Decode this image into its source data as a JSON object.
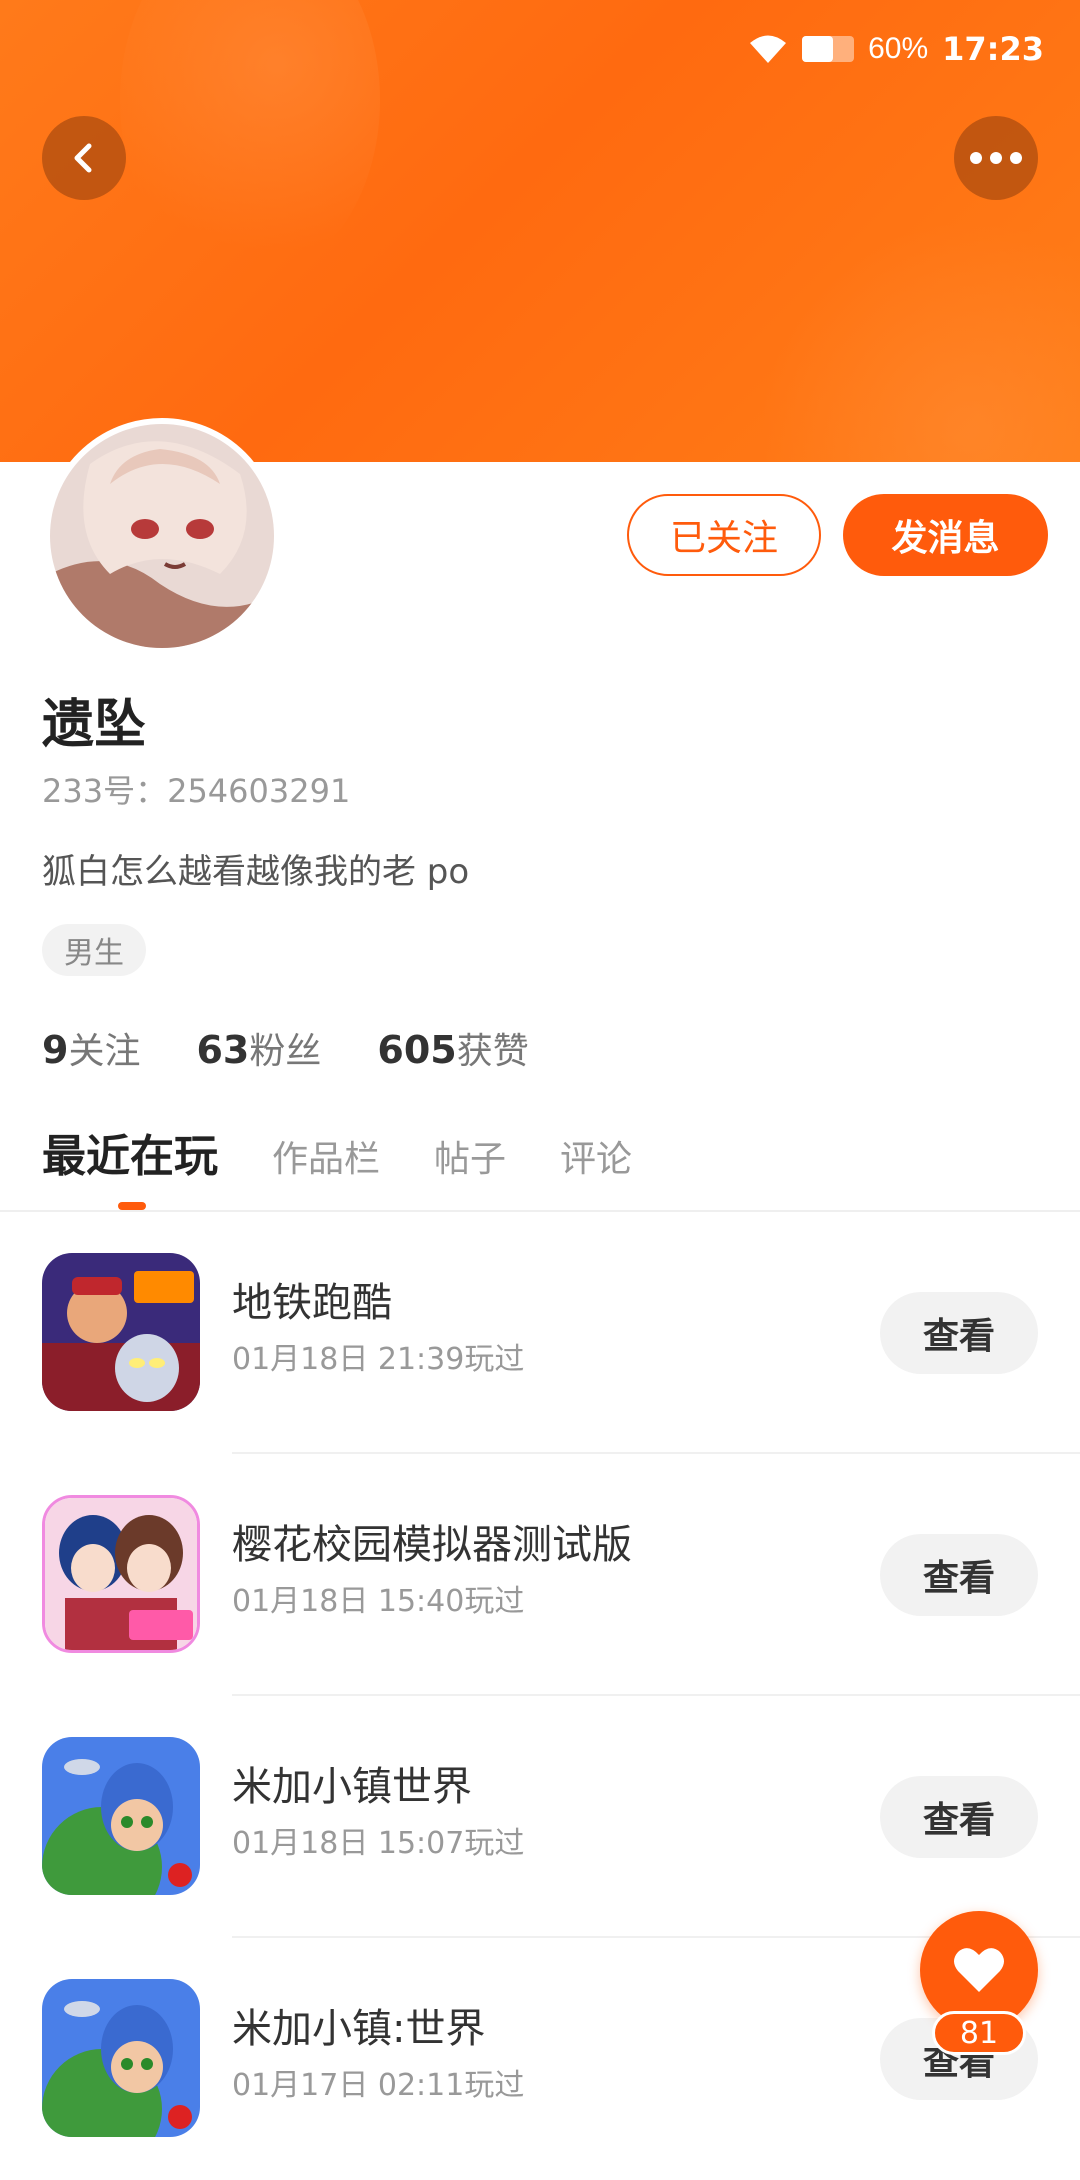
{
  "status_bar": {
    "battery_text": "60%",
    "battery_level": 0.6,
    "time": "17:23",
    "icons": [
      "wifi-icon",
      "battery-icon"
    ]
  },
  "header": {
    "back_icon": "chevron-left-icon",
    "more_icon": "more-horizontal-icon"
  },
  "profile": {
    "name": "遗坠",
    "uid": "233号：254603291",
    "bio": "狐白怎么越看越像我的老 po",
    "tag": "男生",
    "follow_button": "已关注",
    "message_button": "发消息"
  },
  "stats": [
    {
      "num": "9",
      "label": "关注"
    },
    {
      "num": "63",
      "label": "粉丝"
    },
    {
      "num": "605",
      "label": "获赞"
    }
  ],
  "tabs": [
    "最近在玩",
    "作品栏",
    "帖子",
    "评论"
  ],
  "games": [
    {
      "title": "地铁跑酷",
      "time": "01月18日 21:39玩过",
      "action": "查看"
    },
    {
      "title": "樱花校园模拟器测试版",
      "time": "01月18日 15:40玩过",
      "action": "查看"
    },
    {
      "title": "米加小镇世界",
      "time": "01月18日 15:07玩过",
      "action": "查看"
    },
    {
      "title": "米加小镇:世界",
      "time": "01月17日 02:11玩过",
      "action": "查看"
    }
  ],
  "fab": {
    "icon": "heart-icon",
    "count": "81"
  },
  "colors": {
    "accent": "#ff5b0c",
    "banner": "#ff7a1a"
  }
}
